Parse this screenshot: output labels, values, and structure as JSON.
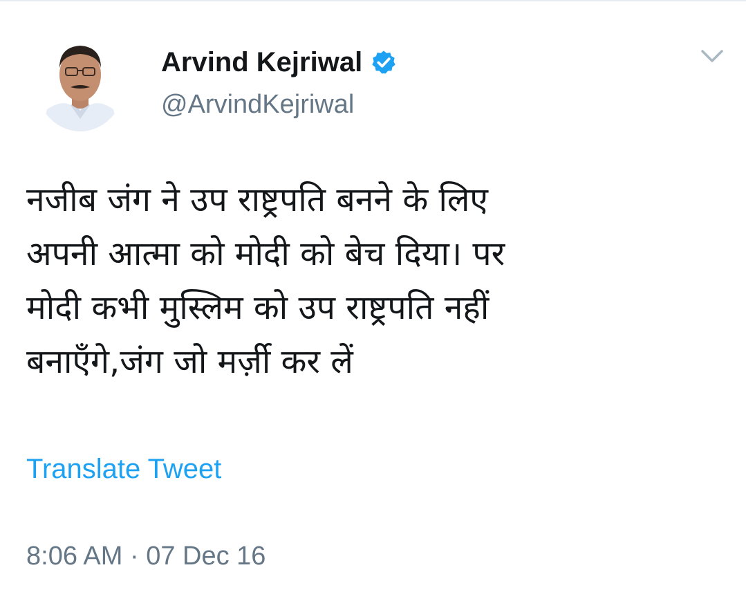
{
  "tweet": {
    "author": {
      "display_name": "Arvind Kejriwal",
      "handle": "@ArvindKejriwal",
      "verified": true,
      "avatar_icon": "profile-photo"
    },
    "text": "नजीब जंग ने उप राष्ट्रपति बनने के लिए\nअपनी आत्मा को मोदी को बेच दिया। पर\nमोदी कभी मुस्लिम को उप राष्ट्रपति नहीं\nबनाएँगे,जंग जो मर्ज़ी कर लें",
    "translate_label": "Translate Tweet",
    "timestamp": "8:06 AM · 07 Dec 16"
  },
  "colors": {
    "link": "#1da1f2",
    "secondary_text": "#657786",
    "primary_text": "#14171a",
    "verified_badge": "#1da1f2"
  },
  "icons": {
    "menu": "chevron-down-icon",
    "verified": "verified-badge-icon"
  }
}
